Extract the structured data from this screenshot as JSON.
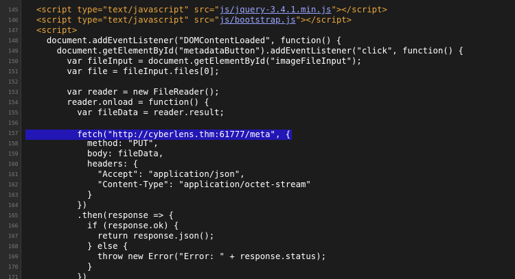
{
  "line_numbers": [
    "145",
    "146",
    "147",
    "148",
    "149",
    "150",
    "151",
    "152",
    "153",
    "154",
    "155",
    "156",
    "157",
    "158",
    "159",
    "160",
    "161",
    "162",
    "163",
    "164",
    "165",
    "166",
    "167",
    "168",
    "169",
    "170",
    "171"
  ],
  "lines": [
    {
      "indent": "",
      "parts": [
        {
          "t": "<script ",
          "c": "tag"
        },
        {
          "t": "type=",
          "c": "attr"
        },
        {
          "t": "\"text/javascript\"",
          "c": "str"
        },
        {
          "t": " src=",
          "c": "attr"
        },
        {
          "t": "\"",
          "c": "str"
        },
        {
          "t": "js/jquery-3.4.1.min.js",
          "c": "link"
        },
        {
          "t": "\"",
          "c": "str"
        },
        {
          "t": "></",
          "c": "tag"
        },
        {
          "t": "script>",
          "c": "tag"
        }
      ]
    },
    {
      "indent": "",
      "parts": [
        {
          "t": "<script ",
          "c": "tag"
        },
        {
          "t": "type=",
          "c": "attr"
        },
        {
          "t": "\"text/javascript\"",
          "c": "str"
        },
        {
          "t": " src=",
          "c": "attr"
        },
        {
          "t": "\"",
          "c": "str"
        },
        {
          "t": "js/bootstrap.js",
          "c": "link"
        },
        {
          "t": "\"",
          "c": "str"
        },
        {
          "t": "></",
          "c": "tag"
        },
        {
          "t": "script>",
          "c": "tag"
        }
      ]
    },
    {
      "indent": "",
      "parts": [
        {
          "t": "<script>",
          "c": "tag"
        }
      ]
    },
    {
      "indent": "  ",
      "parts": [
        {
          "t": "document.addEventListener(\"DOMContentLoaded\", function() {",
          "c": "plain"
        }
      ]
    },
    {
      "indent": "    ",
      "parts": [
        {
          "t": "document.getElementById(\"metadataButton\").addEventListener(\"click\", function() {",
          "c": "plain"
        }
      ]
    },
    {
      "indent": "      ",
      "parts": [
        {
          "t": "var fileInput = document.getElementById(\"imageFileInput\");",
          "c": "plain"
        }
      ]
    },
    {
      "indent": "      ",
      "parts": [
        {
          "t": "var file = fileInput.files[0];",
          "c": "plain"
        }
      ]
    },
    {
      "indent": "",
      "parts": []
    },
    {
      "indent": "      ",
      "parts": [
        {
          "t": "var reader = new FileReader();",
          "c": "plain"
        }
      ]
    },
    {
      "indent": "      ",
      "parts": [
        {
          "t": "reader.onload = function() {",
          "c": "plain"
        }
      ]
    },
    {
      "indent": "        ",
      "parts": [
        {
          "t": "var fileData = reader.result;",
          "c": "plain"
        }
      ]
    },
    {
      "indent": "",
      "parts": []
    },
    {
      "indent": "        ",
      "highlight": true,
      "parts": [
        {
          "t": "fetch(\"http://cyberlens.thm:61777/meta\", {",
          "c": "plain"
        }
      ]
    },
    {
      "indent": "          ",
      "parts": [
        {
          "t": "method: \"PUT\",",
          "c": "plain"
        }
      ]
    },
    {
      "indent": "          ",
      "parts": [
        {
          "t": "body: fileData,",
          "c": "plain"
        }
      ]
    },
    {
      "indent": "          ",
      "parts": [
        {
          "t": "headers: {",
          "c": "plain"
        }
      ]
    },
    {
      "indent": "            ",
      "parts": [
        {
          "t": "\"Accept\": \"application/json\",",
          "c": "plain"
        }
      ]
    },
    {
      "indent": "            ",
      "parts": [
        {
          "t": "\"Content-Type\": \"application/octet-stream\"",
          "c": "plain"
        }
      ]
    },
    {
      "indent": "          ",
      "parts": [
        {
          "t": "}",
          "c": "plain"
        }
      ]
    },
    {
      "indent": "        ",
      "parts": [
        {
          "t": "})",
          "c": "plain"
        }
      ]
    },
    {
      "indent": "        ",
      "parts": [
        {
          "t": ".then(response => {",
          "c": "plain"
        }
      ]
    },
    {
      "indent": "          ",
      "parts": [
        {
          "t": "if (response.ok) {",
          "c": "plain"
        }
      ]
    },
    {
      "indent": "            ",
      "parts": [
        {
          "t": "return response.json();",
          "c": "plain"
        }
      ]
    },
    {
      "indent": "          ",
      "parts": [
        {
          "t": "} else {",
          "c": "plain"
        }
      ]
    },
    {
      "indent": "            ",
      "parts": [
        {
          "t": "throw new Error(\"Error: \" + response.status);",
          "c": "plain"
        }
      ]
    },
    {
      "indent": "          ",
      "parts": [
        {
          "t": "}",
          "c": "plain"
        }
      ]
    },
    {
      "indent": "        ",
      "parts": [
        {
          "t": "})",
          "c": "plain"
        }
      ]
    }
  ],
  "colors": {
    "background": "#1c1c1c",
    "gutter": "#2b2b2b",
    "highlight": "#2216b5",
    "tag": "#e8a63c",
    "link": "#9aa4ff",
    "text": "#ffffff"
  }
}
